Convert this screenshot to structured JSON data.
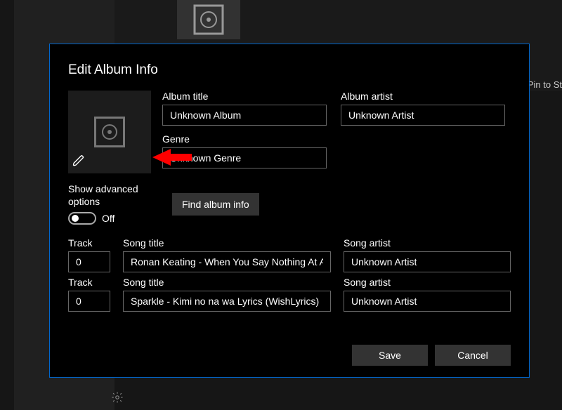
{
  "background": {
    "pin_label": "Pin to St"
  },
  "dialog": {
    "title": "Edit Album Info",
    "album_title_label": "Album title",
    "album_title_value": "Unknown Album",
    "album_artist_label": "Album artist",
    "album_artist_value": "Unknown Artist",
    "genre_label": "Genre",
    "genre_value": "Unknown Genre",
    "advanced_label": "Show advanced options",
    "advanced_state": "Off",
    "find_button": "Find album info",
    "track_label": "Track",
    "song_title_label": "Song title",
    "song_artist_label": "Song artist",
    "tracks": [
      {
        "num": "0",
        "title": "Ronan Keating - When You Say Nothing At Al",
        "artist": "Unknown Artist"
      },
      {
        "num": "0",
        "title": "Sparkle - Kimi no na wa Lyrics (WishLyrics)",
        "artist": "Unknown Artist"
      }
    ],
    "save": "Save",
    "cancel": "Cancel"
  }
}
